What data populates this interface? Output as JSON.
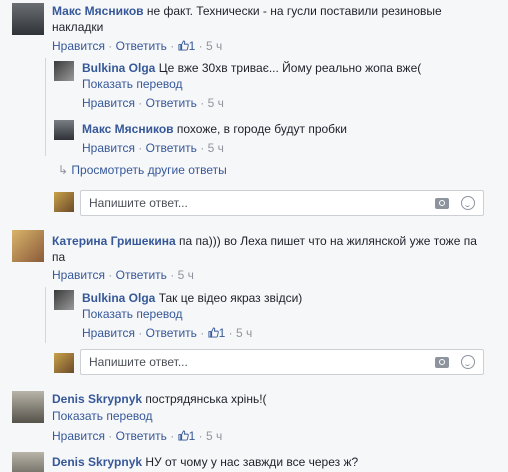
{
  "comments": [
    {
      "name": "Макс Мясников",
      "text": "не факт. Технически - на гусли поставили резиновые накладки",
      "like": "Нравится",
      "reply": "Ответить",
      "likes": "1",
      "time": "5 ч"
    },
    {
      "name": "Bulkina Olga",
      "text": "Це вже 30хв триває... Йому реально жопа вже(",
      "translate": "Показать перевод",
      "like": "Нравится",
      "reply": "Ответить",
      "time": "5 ч"
    },
    {
      "name": "Макс Мясников",
      "text": "похоже, в городе будут пробки",
      "like": "Нравится",
      "reply": "Ответить",
      "time": "5 ч"
    },
    {
      "name": "Катерина Гришекина",
      "text": "па па))) во Леха пишет что на жилянской уже тоже па па",
      "like": "Нравится",
      "reply": "Ответить",
      "time": "5 ч"
    },
    {
      "name": "Bulkina Olga",
      "text": "Так це відео якраз звідси)",
      "translate": "Показать перевод",
      "like": "Нравится",
      "reply": "Ответить",
      "likes": "1",
      "time": "5 ч"
    },
    {
      "name": "Denis Skrypnyk",
      "text": "пострядянська хрінь!(",
      "translate": "Показать перевод",
      "like": "Нравится",
      "reply": "Ответить",
      "likes": "1",
      "time": "5 ч"
    },
    {
      "name": "Denis Skrypnyk",
      "text": "НУ от чому у нас завжди все через ж?"
    }
  ],
  "more_replies": "Просмотреть другие ответы",
  "reply_placeholder": "Напишите ответ...",
  "sep": "·"
}
